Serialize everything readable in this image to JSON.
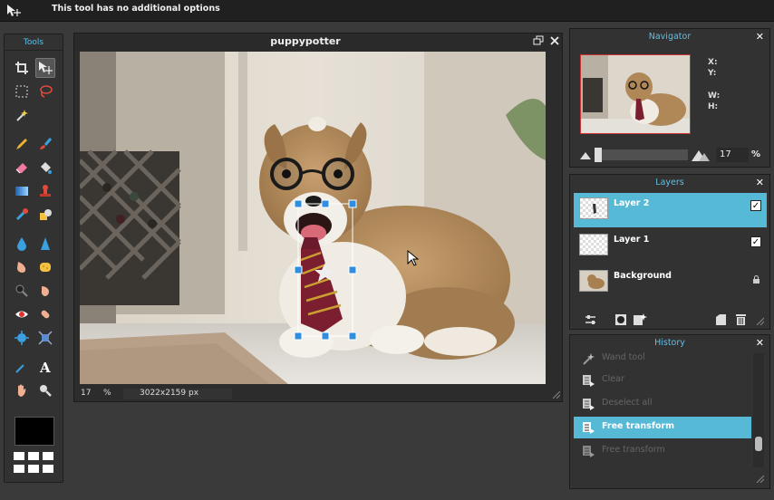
{
  "options_bar": {
    "message": "This tool has no additional options"
  },
  "tools": {
    "header": "Tools",
    "items": [
      "crop-icon",
      "move-icon",
      "marquee-select-icon",
      "lasso-icon",
      "magic-wand-icon",
      "pencil-icon",
      "brush-icon",
      "eraser-icon",
      "paint-bucket-icon",
      "gradient-icon",
      "clone-stamp-icon",
      "color-replace-icon",
      "drawing-icon",
      "blur-icon",
      "sharpen-icon",
      "smudge-icon",
      "sponge-icon",
      "dodge-icon",
      "burn-icon",
      "red-eye-icon",
      "spot-heal-icon",
      "bloat-icon",
      "pinch-icon",
      "color-picker-icon",
      "type-icon",
      "hand-icon",
      "zoom-icon"
    ],
    "foreground_color": "#000000"
  },
  "document": {
    "title": "puppypotter",
    "zoom": "17",
    "zoom_unit": "%",
    "dimensions": "3022x2159 px"
  },
  "navigator": {
    "header": "Navigator",
    "x_label": "X:",
    "y_label": "Y:",
    "w_label": "W:",
    "h_label": "H:",
    "zoom": "17",
    "zoom_unit": "%"
  },
  "layers": {
    "header": "Layers",
    "items": [
      {
        "name": "Layer 2",
        "selected": true,
        "visible": true
      },
      {
        "name": "Layer 1",
        "selected": false,
        "visible": true
      },
      {
        "name": "Background",
        "selected": false,
        "locked": true
      }
    ]
  },
  "history": {
    "header": "History",
    "items": [
      "Wand tool",
      "Clear",
      "Deselect all",
      "Free transform",
      "Free transform"
    ],
    "selected_index": 3
  },
  "colors": {
    "accent": "#56b9d6",
    "header_text": "#5fc0e6",
    "handle": "#2f8ee0"
  }
}
